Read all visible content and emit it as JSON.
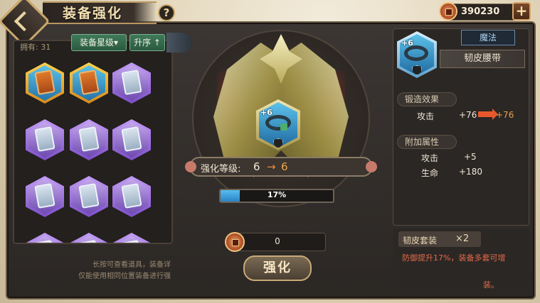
{
  "header": {
    "title": "装备强化",
    "help_symbol": "?",
    "currency_value": "390230",
    "add_symbol": "+"
  },
  "inventory": {
    "own_label": "拥有: 31",
    "sort_star_label": "装备星级▾",
    "sort_order_label": "升序 ↑",
    "hint_line1": "长按可查看道具，装备详",
    "hint_line2": "仅能使用相同位置装备进行强",
    "items": [
      {
        "rarity": "orange"
      },
      {
        "rarity": "orange"
      },
      {
        "rarity": "purple"
      },
      {
        "rarity": "purple"
      },
      {
        "rarity": "purple"
      },
      {
        "rarity": "purple"
      },
      {
        "rarity": "purple"
      },
      {
        "rarity": "purple"
      },
      {
        "rarity": "purple"
      },
      {
        "rarity": "purple"
      },
      {
        "rarity": "purple"
      },
      {
        "rarity": "purple"
      }
    ]
  },
  "center": {
    "plus_badge": "+6",
    "level_label": "强化等级:",
    "level_from": "6",
    "level_arrow": "→",
    "level_to": "6",
    "progress_percent": 17,
    "progress_text": "17%",
    "cost_value": "0",
    "enhance_label": "强化"
  },
  "detail": {
    "plus_badge": "+6",
    "type_tag": "魔法",
    "item_name": "韧皮腰带",
    "forge_header": "锻造效果",
    "forge_stat_label": "攻击",
    "forge_from": "+76",
    "forge_to": "+76",
    "extra_header": "附加属性",
    "extra_stats": [
      {
        "label": "攻击",
        "value": "+5"
      },
      {
        "label": "生命",
        "value": "+180"
      }
    ],
    "set_name": "韧皮套装",
    "set_count": "×2",
    "set_desc_line1": "防御提升17%，装备多套可增",
    "set_desc_line2": "装。"
  },
  "colors": {
    "accent_gold": "#c9a86a",
    "progress_blue": "#58bdf0",
    "arrow_orange": "#e8582c",
    "set_desc_red": "#e26a4a"
  }
}
